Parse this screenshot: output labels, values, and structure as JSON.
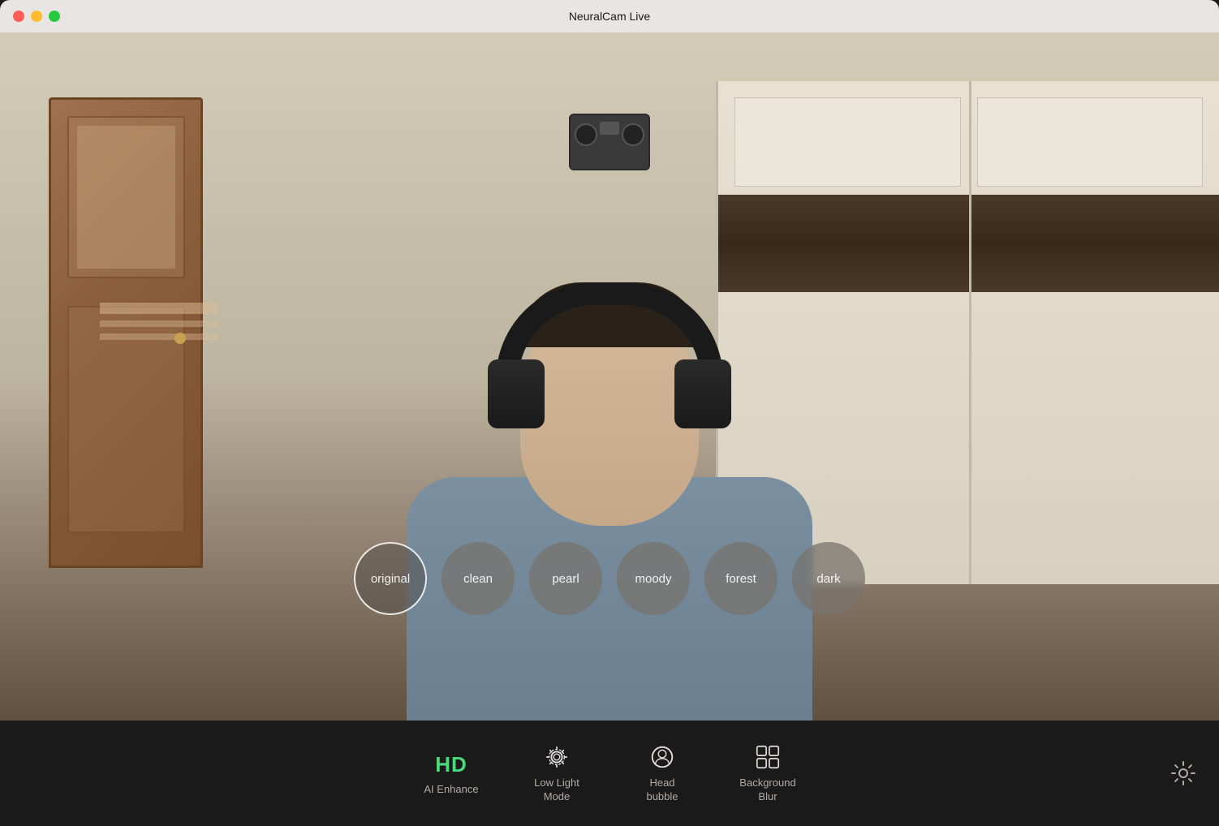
{
  "window": {
    "title": "NeuralCam Live"
  },
  "titlebar": {
    "close_label": "",
    "minimize_label": "",
    "maximize_label": ""
  },
  "filters": [
    {
      "id": "original",
      "label": "original",
      "active": true
    },
    {
      "id": "clean",
      "label": "clean",
      "active": false
    },
    {
      "id": "pearl",
      "label": "pearl",
      "active": false
    },
    {
      "id": "moody",
      "label": "moody",
      "active": false
    },
    {
      "id": "forest",
      "label": "forest",
      "active": false
    },
    {
      "id": "dark",
      "label": "dark",
      "active": false
    }
  ],
  "toolbar": {
    "items": [
      {
        "id": "hd",
        "label": "HD",
        "sublabel": "AI Enhance",
        "type": "hd"
      },
      {
        "id": "lowlight",
        "label": "Low Light\nMode",
        "label_line1": "Low Light",
        "label_line2": "Mode",
        "type": "icon"
      },
      {
        "id": "headbubble",
        "label": "Head\nbubble",
        "label_line1": "Head",
        "label_line2": "bubble",
        "type": "icon"
      },
      {
        "id": "bgblur",
        "label": "Background\nBlur",
        "label_line1": "Background",
        "label_line2": "Blur",
        "type": "icon"
      }
    ],
    "settings_label": "settings"
  }
}
